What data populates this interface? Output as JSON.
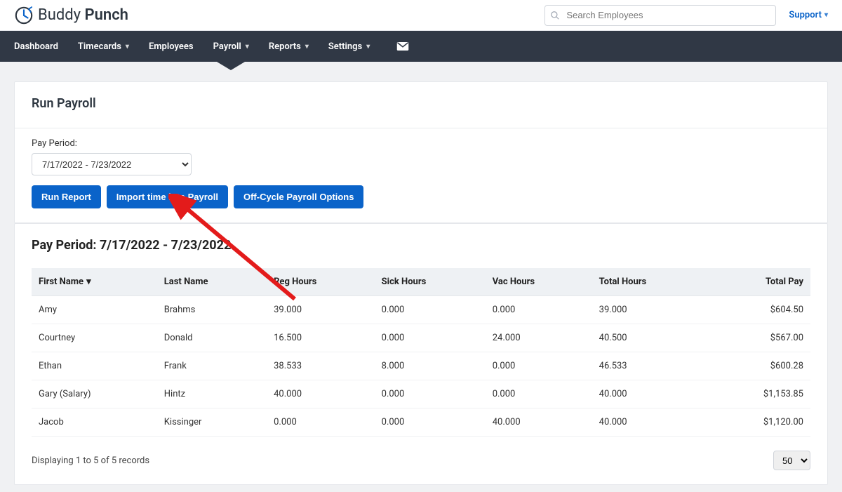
{
  "brand": {
    "name_a": "Buddy",
    "name_b": " Punch"
  },
  "search": {
    "placeholder": "Search Employees"
  },
  "support_link": "Support",
  "nav": {
    "dashboard": "Dashboard",
    "timecards": "Timecards",
    "employees": "Employees",
    "payroll": "Payroll",
    "reports": "Reports",
    "settings": "Settings"
  },
  "run_panel": {
    "title": "Run Payroll",
    "pay_period_label": "Pay Period:",
    "pay_period_value": "7/17/2022 - 7/23/2022",
    "run_report": "Run Report",
    "import_time": "Import time into Payroll",
    "off_cycle": "Off-Cycle Payroll Options"
  },
  "results": {
    "title": "Pay Period: 7/17/2022 - 7/23/2022",
    "columns": {
      "first_name": "First Name",
      "last_name": "Last Name",
      "reg_hours": "Reg Hours",
      "sick_hours": "Sick Hours",
      "vac_hours": "Vac Hours",
      "total_hours": "Total Hours",
      "total_pay": "Total Pay"
    },
    "rows": [
      {
        "first": "Amy",
        "last": "Brahms",
        "reg": "39.000",
        "sick": "0.000",
        "vac": "0.000",
        "total": "39.000",
        "pay": "$604.50"
      },
      {
        "first": "Courtney",
        "last": "Donald",
        "reg": "16.500",
        "sick": "0.000",
        "vac": "24.000",
        "total": "40.500",
        "pay": "$567.00"
      },
      {
        "first": "Ethan",
        "last": "Frank",
        "reg": "38.533",
        "sick": "8.000",
        "vac": "0.000",
        "total": "46.533",
        "pay": "$600.28"
      },
      {
        "first": "Gary (Salary)",
        "last": "Hintz",
        "reg": "40.000",
        "sick": "0.000",
        "vac": "0.000",
        "total": "40.000",
        "pay": "$1,153.85"
      },
      {
        "first": "Jacob",
        "last": "Kissinger",
        "reg": "0.000",
        "sick": "0.000",
        "vac": "40.000",
        "total": "40.000",
        "pay": "$1,120.00"
      }
    ],
    "footer_text": "Displaying 1 to 5 of 5 records",
    "page_size": "50"
  }
}
